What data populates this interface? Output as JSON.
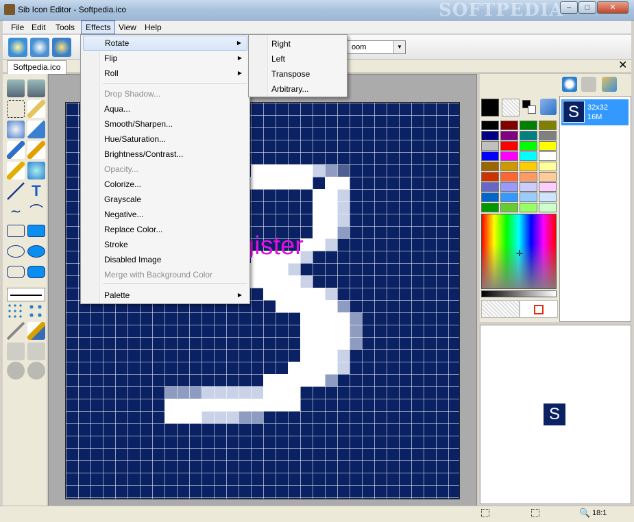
{
  "window": {
    "title": "Sib Icon Editor - Softpedia.ico",
    "watermark": "SOFTPEDIA"
  },
  "window_controls": {
    "minimize": "–",
    "maximize": "□",
    "close": "✕"
  },
  "menubar": {
    "items": [
      "File",
      "Edit",
      "Tools",
      "Effects",
      "View",
      "Help"
    ]
  },
  "toolbar": {
    "zoom_value": "oom"
  },
  "document": {
    "tab": "Softpedia.ico",
    "close": "✕"
  },
  "effects_menu": {
    "items": [
      {
        "label": "Rotate",
        "submenu": true,
        "disabled": false
      },
      {
        "label": "Flip",
        "submenu": true,
        "disabled": false
      },
      {
        "label": "Roll",
        "submenu": true,
        "disabled": false
      },
      {
        "label": "Drop Shadow...",
        "submenu": false,
        "disabled": true
      },
      {
        "label": "Aqua...",
        "submenu": false,
        "disabled": false
      },
      {
        "label": "Smooth/Sharpen...",
        "submenu": false,
        "disabled": false
      },
      {
        "label": "Hue/Saturation...",
        "submenu": false,
        "disabled": false
      },
      {
        "label": "Brightness/Contrast...",
        "submenu": false,
        "disabled": false
      },
      {
        "label": "Opacity...",
        "submenu": false,
        "disabled": true
      },
      {
        "label": "Colorize...",
        "submenu": false,
        "disabled": false
      },
      {
        "label": "Grayscale",
        "submenu": false,
        "disabled": false
      },
      {
        "label": "Negative...",
        "submenu": false,
        "disabled": false
      },
      {
        "label": "Replace Color...",
        "submenu": false,
        "disabled": false
      },
      {
        "label": "Stroke",
        "submenu": false,
        "disabled": false
      },
      {
        "label": "Disabled Image",
        "submenu": false,
        "disabled": false
      },
      {
        "label": "Merge with Background Color",
        "submenu": false,
        "disabled": true
      },
      {
        "label": "Palette",
        "submenu": true,
        "disabled": false
      }
    ]
  },
  "rotate_submenu": {
    "items": [
      "Right",
      "Left",
      "Transpose",
      "Arbitrary..."
    ]
  },
  "canvas": {
    "overlay_text": "gister"
  },
  "palette": {
    "colors": [
      "#000000",
      "#800000",
      "#008000",
      "#808000",
      "#000080",
      "#800080",
      "#008080",
      "#808080",
      "#c0c0c0",
      "#ff0000",
      "#00ff00",
      "#ffff00",
      "#0000ff",
      "#ff00ff",
      "#00ffff",
      "#ffffff",
      "#996600",
      "#cc9900",
      "#ffcc00",
      "#ffff99",
      "#cc3300",
      "#ff6633",
      "#ff9966",
      "#ffcc99",
      "#6666cc",
      "#9999ff",
      "#ccccff",
      "#ffccff",
      "#0066cc",
      "#3399ff",
      "#99ccff",
      "#cce6ff",
      "#009900",
      "#66cc33",
      "#99ff66",
      "#ccffcc"
    ],
    "primary": "#000000",
    "secondary": "transparent"
  },
  "image_list": {
    "thumb_letter": "S",
    "size": "32x32",
    "depth": "16M"
  },
  "preview": {
    "thumb_letter": "S"
  },
  "status": {
    "zoom": "18:1"
  }
}
